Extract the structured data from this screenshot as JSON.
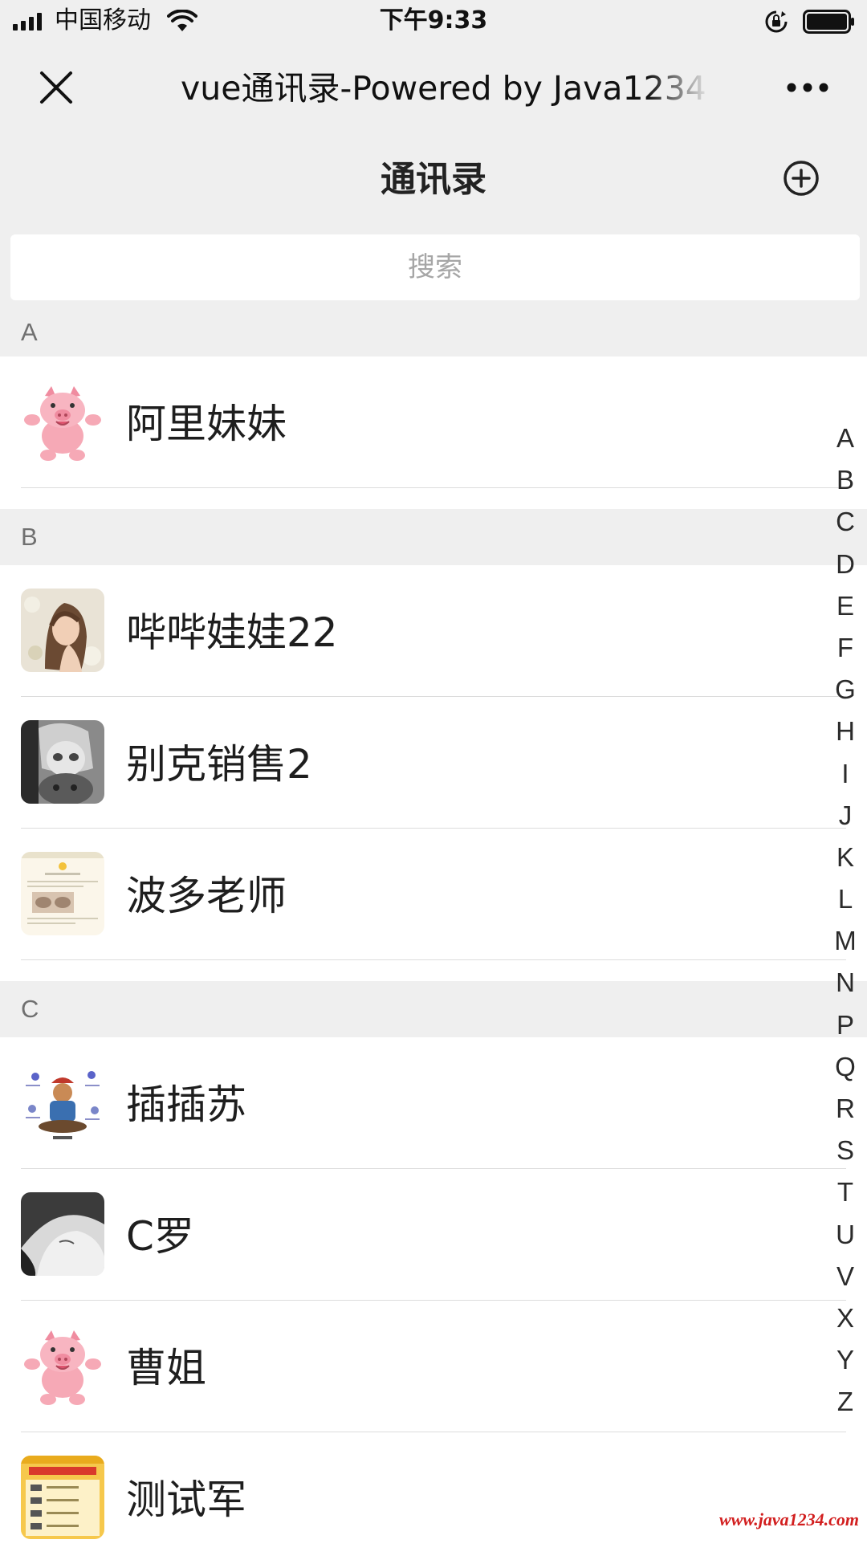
{
  "status_bar": {
    "carrier": "中国移动",
    "time": "下午9:33",
    "icons": [
      "signal-icon",
      "wifi-icon",
      "rotation-lock-icon",
      "battery-icon"
    ]
  },
  "nav": {
    "title": "vue通讯录-Powered by Java1234",
    "close_icon": "close-icon",
    "more_icon": "more-icon"
  },
  "header": {
    "title": "通讯录",
    "add_icon": "plus-circle-icon"
  },
  "search": {
    "placeholder": "搜索",
    "value": ""
  },
  "sections": [
    {
      "letter": "A",
      "contacts": [
        {
          "name": "阿里妹妹",
          "avatar": "pink-pig-avatar"
        }
      ]
    },
    {
      "letter": "B",
      "contacts": [
        {
          "name": "哔哔娃娃22",
          "avatar": "woman-photo-avatar"
        },
        {
          "name": "别克销售2",
          "avatar": "anime-gray-avatar"
        },
        {
          "name": "波多老师",
          "avatar": "webpage-screenshot-avatar"
        }
      ]
    },
    {
      "letter": "C",
      "contacts": [
        {
          "name": "插插苏",
          "avatar": "cartoon-diagram-avatar"
        },
        {
          "name": "C罗",
          "avatar": "anime-bw-avatar"
        },
        {
          "name": "曹姐",
          "avatar": "pink-pig-avatar"
        },
        {
          "name": "测试军",
          "avatar": "app-screenshot-avatar"
        }
      ]
    }
  ],
  "index_letters": [
    "A",
    "B",
    "C",
    "D",
    "E",
    "F",
    "G",
    "H",
    "I",
    "J",
    "K",
    "L",
    "M",
    "N",
    "P",
    "Q",
    "R",
    "S",
    "T",
    "U",
    "V",
    "X",
    "Y",
    "Z"
  ],
  "watermark": "www.java1234.com",
  "colors": {
    "bar_background": "#efefef",
    "section_background": "#efefef",
    "divider": "#dcdcdc",
    "watermark": "#d21f1f"
  }
}
